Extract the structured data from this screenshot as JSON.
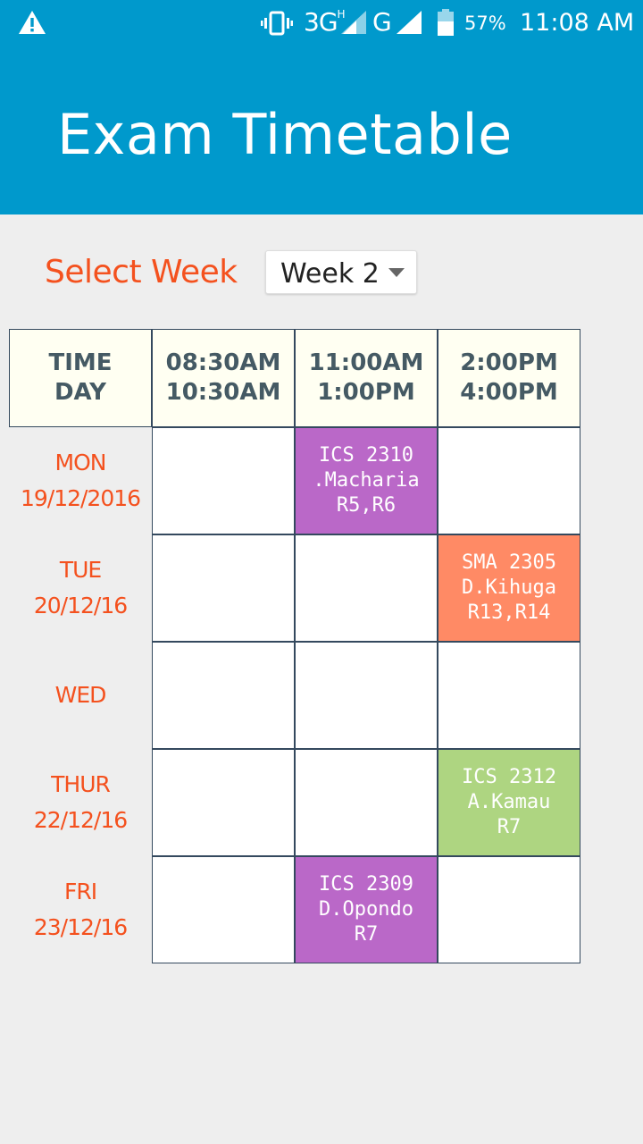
{
  "status_bar": {
    "network_3g": "3G",
    "network_3g_sup": "H",
    "network_g": "G",
    "battery": "57%",
    "time": "11:08 AM",
    "icons": [
      "warning-icon",
      "vibrate-icon",
      "signal-icon",
      "battery-icon"
    ]
  },
  "app": {
    "title": "Exam Timetable",
    "color": "#0099cc"
  },
  "week_selector": {
    "label": "Select Week",
    "selected": "Week 2"
  },
  "timetable": {
    "header": {
      "corner": [
        "TIME",
        "DAY"
      ],
      "slots": [
        [
          "08:30AM",
          "10:30AM"
        ],
        [
          "11:00AM",
          "1:00PM"
        ],
        [
          "2:00PM",
          "4:00PM"
        ]
      ]
    },
    "rows": [
      {
        "day": "MON",
        "date": "19/12/2016",
        "cells": [
          null,
          {
            "lines": [
              "ICS 2310",
              ".Macharia",
              "R5,R6"
            ],
            "color": "#ba68c8"
          },
          null
        ]
      },
      {
        "day": "TUE",
        "date": "20/12/16",
        "cells": [
          null,
          null,
          {
            "lines": [
              "SMA 2305",
              "D.Kihuga",
              "R13,R14"
            ],
            "color": "#ff8a65"
          }
        ]
      },
      {
        "day": "WED",
        "date": "",
        "cells": [
          null,
          null,
          null
        ]
      },
      {
        "day": "THUR",
        "date": "22/12/16",
        "cells": [
          null,
          null,
          {
            "lines": [
              "ICS 2312",
              "A.Kamau",
              "R7"
            ],
            "color": "#aed581"
          }
        ]
      },
      {
        "day": "FRI",
        "date": "23/12/16",
        "cells": [
          null,
          {
            "lines": [
              "ICS 2309",
              "D.Opondo",
              "R7"
            ],
            "color": "#ba68c8"
          },
          null
        ]
      }
    ]
  }
}
